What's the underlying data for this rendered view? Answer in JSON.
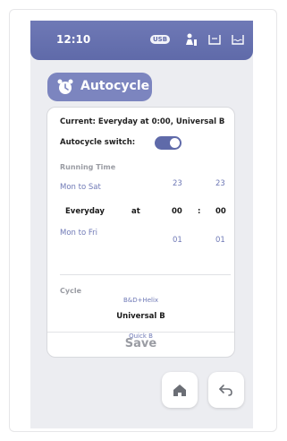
{
  "status_bar": {
    "time": "12:10",
    "usb_label": "USB",
    "icons": [
      "usb-icon",
      "user-alert-icon",
      "tray-icon",
      "water-tank-icon"
    ]
  },
  "autocycle": {
    "label": "Autocycle",
    "icon": "alarm-clock-icon"
  },
  "card": {
    "current": "Current:  Everyday at 0:00,  Universal B",
    "switch_label": "Autocycle switch:",
    "switch_on": true,
    "running_time_label": "Running Time",
    "rows": {
      "above": {
        "day": "Mon to Sat",
        "hour": "23",
        "minute": "23"
      },
      "selected": {
        "day": "Everyday",
        "at": "at",
        "hour": "00",
        "sep": ":",
        "minute": "00"
      },
      "below": {
        "day": "Mon to Fri",
        "hour": "01",
        "minute": "01"
      }
    },
    "cycle_label": "Cycle",
    "cycle_options": {
      "above": "B&D+Helix",
      "selected": "Universal B",
      "below": "Quick B"
    },
    "save_label": "Save"
  },
  "nav": {
    "home_icon": "home-icon",
    "back_icon": "back-arrow-icon"
  },
  "colors": {
    "accent": "#6f79b6",
    "accent_dark": "#5f6aa9",
    "button": "#7c85bf",
    "muted": "#9a9ca3",
    "screen_bg": "#ecedf1"
  }
}
